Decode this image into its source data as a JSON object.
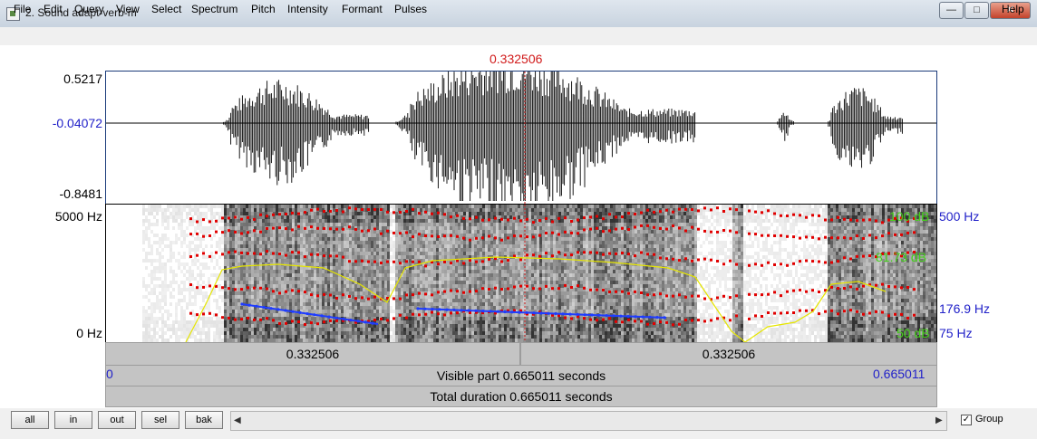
{
  "window": {
    "title": "2. Sound adapt-verb-m",
    "minimize": "—",
    "maximize": "□",
    "close": "✕"
  },
  "menu": {
    "items": [
      "File",
      "Edit",
      "Query",
      "View",
      "Select",
      "Spectrum",
      "Pitch",
      "Intensity",
      "Formant",
      "Pulses"
    ],
    "help": "Help"
  },
  "editor": {
    "cursor_time": "0.332506",
    "waveform": {
      "max": "0.5217",
      "mid": "-0.04072",
      "min": "-0.8481"
    },
    "spectrogram": {
      "freq_max": "5000 Hz",
      "freq_min": "0 Hz",
      "right_labels": {
        "db_top": "100 dB",
        "hz_top": "500 Hz",
        "db_mid": "81.73 dB",
        "pitch_value": "176.9 Hz",
        "db_bottom": "50 dB",
        "hz_bottom": "75 Hz"
      }
    },
    "time_row": {
      "left": "0.332506",
      "right": "0.332506"
    },
    "visible": {
      "start": "0",
      "label": "Visible part 0.665011 seconds",
      "end": "0.665011"
    },
    "total": {
      "label": "Total duration 0.665011 seconds"
    }
  },
  "bottom": {
    "buttons": [
      "all",
      "in",
      "out",
      "sel",
      "bak"
    ],
    "group_label": "Group",
    "group_checked": true
  },
  "colors": {
    "cursor": "#d11a1a",
    "pitch": "#1e3cff",
    "formant": "#e10000",
    "intensity": "#e6e600",
    "db": "#44d11a",
    "hz": "#2121c9"
  }
}
